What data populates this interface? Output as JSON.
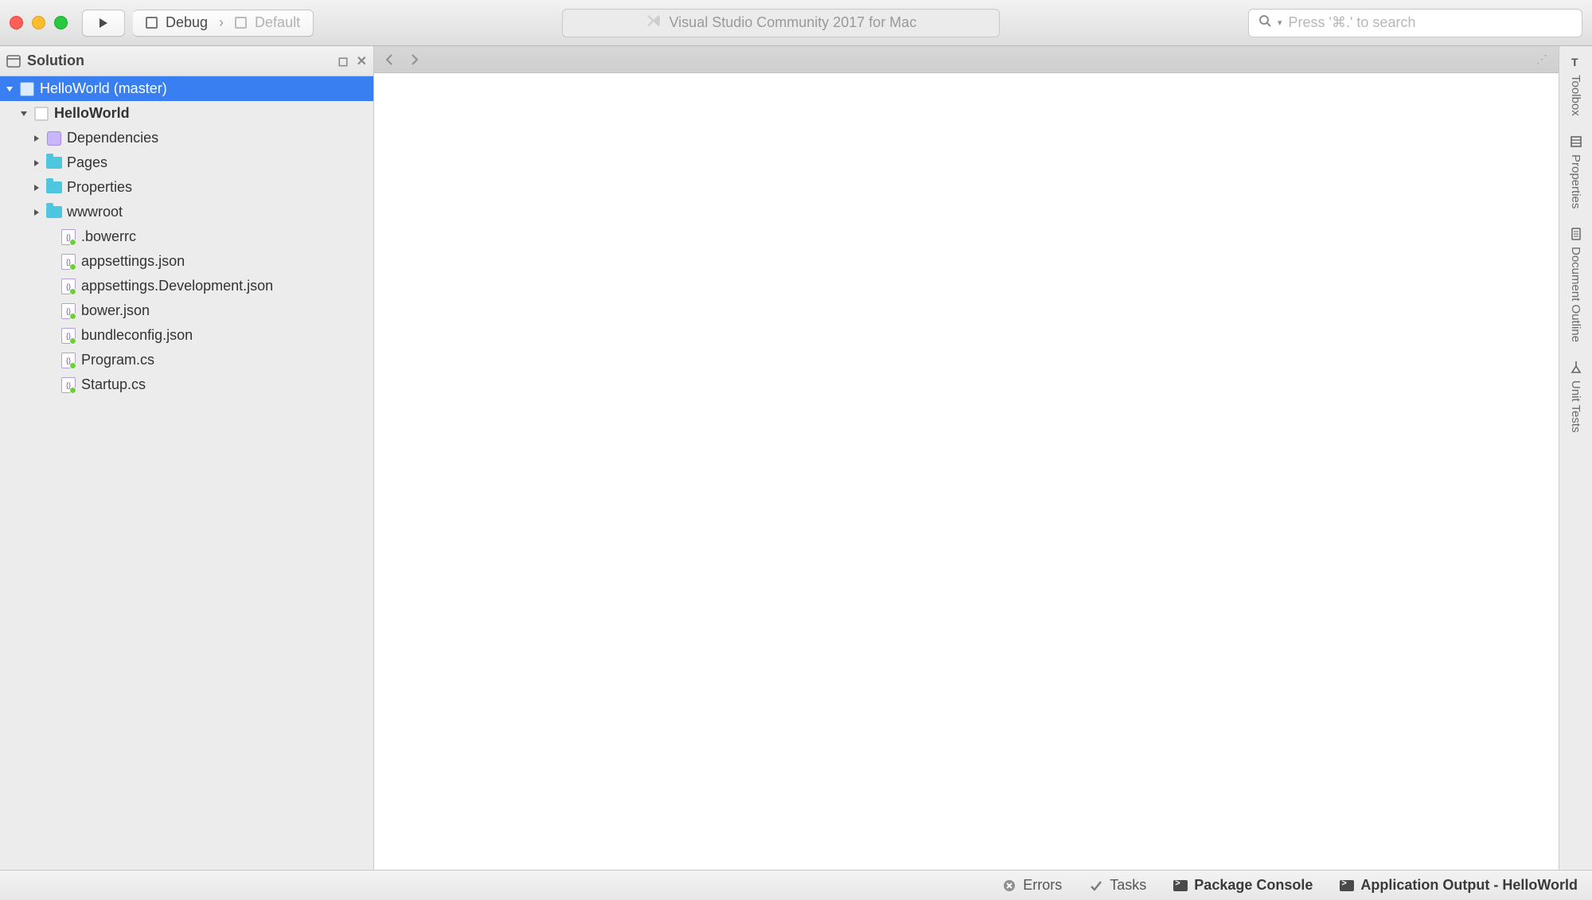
{
  "toolbar": {
    "config_left": "Debug",
    "config_right": "Default",
    "window_title": "Visual Studio Community 2017 for Mac",
    "search_placeholder": "Press '⌘.' to search"
  },
  "solution": {
    "header": "Solution",
    "root": "HelloWorld (master)",
    "project": "HelloWorld",
    "folders": [
      {
        "label": "Dependencies",
        "type": "pkg"
      },
      {
        "label": "Pages",
        "type": "folder"
      },
      {
        "label": "Properties",
        "type": "folder"
      },
      {
        "label": "wwwroot",
        "type": "folder"
      }
    ],
    "files": [
      ".bowerrc",
      "appsettings.json",
      "appsettings.Development.json",
      "bower.json",
      "bundleconfig.json",
      "Program.cs",
      "Startup.cs"
    ]
  },
  "rail": {
    "items": [
      "Toolbox",
      "Properties",
      "Document Outline",
      "Unit Tests"
    ]
  },
  "status": {
    "errors": "Errors",
    "tasks": "Tasks",
    "package_console": "Package Console",
    "app_output": "Application Output - HelloWorld"
  }
}
